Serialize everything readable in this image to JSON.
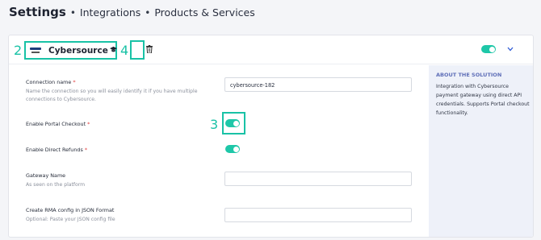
{
  "breadcrumb": {
    "title": "Settings",
    "separator": "•",
    "items": [
      "Integrations",
      "Products & Services"
    ]
  },
  "annotations": [
    "2",
    "3",
    "4"
  ],
  "integration": {
    "name": "Cybersource",
    "enabled": true,
    "logo_icon": "cybersource-logo",
    "icons": [
      "graduation-cap-icon",
      "trash-icon",
      "chevron-down-icon"
    ]
  },
  "form": {
    "connection_name": {
      "label": "Connection name",
      "required": "*",
      "hint": "Name the connection so you will easily identify it if you have multiple connections to Cybersource.",
      "value": "cybersource-182"
    },
    "portal_checkout": {
      "label": "Enable Portal Checkout",
      "required": "*",
      "enabled": true
    },
    "direct_refunds": {
      "label": "Enable Direct Refunds",
      "required": "*",
      "enabled": true
    },
    "gateway_name": {
      "label": "Gateway Name",
      "hint": "As seen on the platform",
      "value": ""
    },
    "rma_config": {
      "label": "Create RMA config in JSON Format",
      "hint": "Optional: Paste your JSON config file",
      "value": ""
    }
  },
  "about": {
    "title": "ABOUT THE SOLUTION",
    "text": "Integration with Cybersource payment gateway using direct API credentials. Supports Portal checkout functionality."
  },
  "colors": {
    "accent": "#1ec7a8",
    "annotation": "#19c2a6",
    "required": "#e23d3d",
    "about_title": "#5f6fb8"
  }
}
